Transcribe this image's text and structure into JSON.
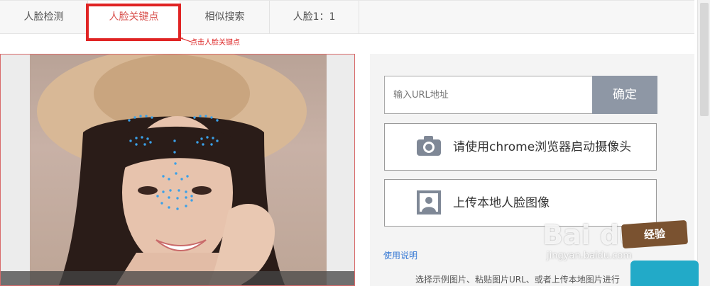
{
  "tabs": [
    {
      "label": "人脸检测",
      "active": false
    },
    {
      "label": "人脸关键点",
      "active": true
    },
    {
      "label": "相似搜索",
      "active": false
    },
    {
      "label": "人脸1：1",
      "active": false
    }
  ],
  "annotation": {
    "text": "点击人脸关键点"
  },
  "form": {
    "url_placeholder": "输入URL地址",
    "ok_label": "确定",
    "camera_label": "请使用chrome浏览器启动摄像头",
    "upload_label": "上传本地人脸图像",
    "help_link": "使用说明",
    "help_text": "选择示例图片、粘贴图片URL、或者上传本地图片进行"
  },
  "watermark": {
    "logo": "Bai du",
    "url": "jingyan.baidu.com",
    "sign": "经验"
  },
  "colors": {
    "active_tab": "#d9534f",
    "highlight_border": "#e02424",
    "ok_button": "#8e97a5",
    "landmark_dot": "#3aa0e8",
    "help_link": "#3a7bd5"
  },
  "icons": [
    "camera-icon",
    "portrait-icon",
    "arrow-icon"
  ]
}
